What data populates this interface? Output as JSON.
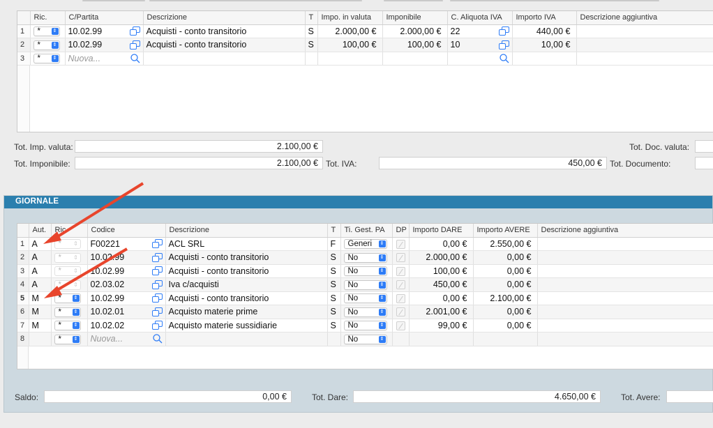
{
  "documento": {
    "columns": [
      "",
      "Ric.",
      "C/Partita",
      "Descrizione",
      "T",
      "Impo. in valuta",
      "Imponibile",
      "C. Aliquota IVA",
      "Importo IVA",
      "Descrizione aggiuntiva"
    ],
    "rows": [
      {
        "n": "1",
        "ric": "*",
        "conto": "10.02.99",
        "descrizione": "Acquisti - conto transitorio",
        "t": "S",
        "valuta": "2.000,00 €",
        "imponibile": "2.000,00 €",
        "aliquota": "22",
        "iva": "440,00 €",
        "agg": ""
      },
      {
        "n": "2",
        "ric": "*",
        "conto": "10.02.99",
        "descrizione": "Acquisti - conto transitorio",
        "t": "S",
        "valuta": "100,00 €",
        "imponibile": "100,00 €",
        "aliquota": "10",
        "iva": "10,00 €",
        "agg": ""
      },
      {
        "n": "3",
        "ric": "*",
        "conto_placeholder": "Nuova..."
      }
    ],
    "totals": {
      "tot_imp_valuta_label": "Tot. Imp. valuta:",
      "tot_imp_valuta": "2.100,00 €",
      "tot_imponibile_label": "Tot. Imponibile:",
      "tot_imponibile": "2.100,00 €",
      "tot_iva_label": "Tot. IVA:",
      "tot_iva": "450,00 €",
      "tot_doc_valuta_label": "Tot. Doc. valuta:",
      "tot_documento_label": "Tot. Documento:"
    }
  },
  "giornale": {
    "title": "GIORNALE",
    "columns": [
      "",
      "Aut.",
      "Ric.",
      "Codice",
      "Descrizione",
      "T",
      "Ti. Gest. PA",
      "DP",
      "Importo DARE",
      "Importo AVERE",
      "Descrizione aggiuntiva"
    ],
    "rows": [
      {
        "n": "1",
        "aut": "A",
        "ric": "*",
        "codice": "F00221",
        "descrizione": "ACL SRL",
        "t": "F",
        "gest": "Generi",
        "dare": "0,00 €",
        "avere": "2.550,00 €"
      },
      {
        "n": "2",
        "aut": "A",
        "ric": "*",
        "codice": "10.02.99",
        "descrizione": "Acquisti - conto transitorio",
        "t": "S",
        "gest": "No",
        "dare": "2.000,00 €",
        "avere": "0,00 €"
      },
      {
        "n": "3",
        "aut": "A",
        "ric": "*",
        "codice": "10.02.99",
        "descrizione": "Acquisti - conto transitorio",
        "t": "S",
        "gest": "No",
        "dare": "100,00 €",
        "avere": "0,00 €"
      },
      {
        "n": "4",
        "aut": "A",
        "ric": "*",
        "codice": "02.03.02",
        "descrizione": "Iva c/acquisti",
        "t": "S",
        "gest": "No",
        "dare": "450,00 €",
        "avere": "0,00 €"
      },
      {
        "n": "5",
        "aut": "M",
        "ric": "*",
        "codice": "10.02.99",
        "descrizione": "Acquisti - conto transitorio",
        "t": "S",
        "gest": "No",
        "dare": "0,00 €",
        "avere": "2.100,00 €"
      },
      {
        "n": "6",
        "aut": "M",
        "ric": "*",
        "codice": "10.02.01",
        "descrizione": "Acquisto materie prime",
        "t": "S",
        "gest": "No",
        "dare": "2.001,00 €",
        "avere": "0,00 €"
      },
      {
        "n": "7",
        "aut": "M",
        "ric": "*",
        "codice": "10.02.02",
        "descrizione": "Acquisto materie sussidiarie",
        "t": "S",
        "gest": "No",
        "dare": "99,00 €",
        "avere": "0,00 €"
      },
      {
        "n": "8",
        "aut": "",
        "ric": "*",
        "codice_placeholder": "Nuova...",
        "gest": "No"
      }
    ],
    "totals": {
      "saldo_label": "Saldo:",
      "saldo": "0,00 €",
      "tot_dare_label": "Tot. Dare:",
      "tot_dare": "4.650,00 €",
      "tot_avere_label": "Tot. Avere:"
    }
  },
  "annotation": {
    "arrow_color": "#e8452c"
  }
}
